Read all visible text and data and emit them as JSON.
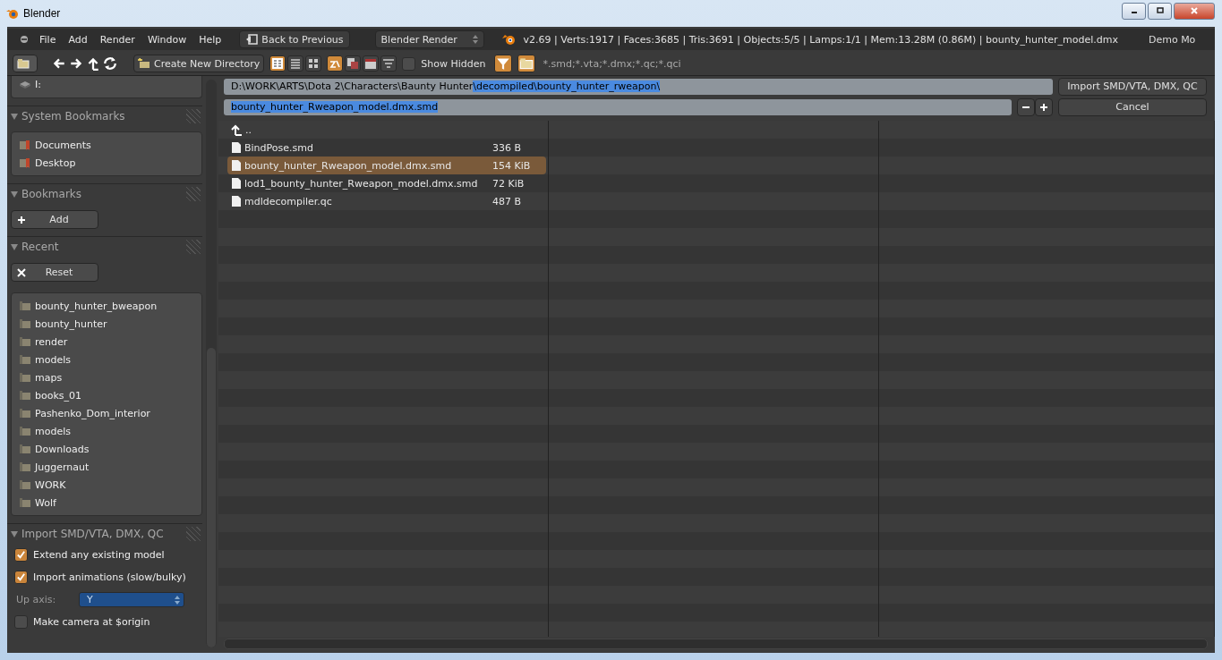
{
  "window": {
    "title": "Blender"
  },
  "menu": [
    "File",
    "Add",
    "Render",
    "Window",
    "Help"
  ],
  "back_button": "Back to Previous",
  "render_engine": "Blender Render",
  "stats": "v2.69 | Verts:1917 | Faces:3685 | Tris:3691 | Objects:5/5 | Lamps:1/1 | Mem:13.28M (0.86M) | bounty_hunter_model.dmx",
  "screen_layout": "Demo Mo",
  "toolbar": {
    "create_directory": "Create New Directory",
    "display_modes": [
      {
        "selected": true
      },
      {
        "selected": false
      },
      {
        "selected": false
      }
    ],
    "sort_modes": [
      {
        "selected": true
      },
      {
        "selected": false
      },
      {
        "selected": false
      },
      {
        "selected": false
      }
    ],
    "show_hidden": {
      "label": "Show Hidden",
      "checked": false
    },
    "filter": {
      "on": true
    },
    "folders_filter": {
      "on": true
    },
    "filter_glob": "*.smd;*.vta;*.dmx;*.qc;*.qci"
  },
  "path": {
    "text": "D:\\WORK\\ARTS\\Dota 2\\Characters\\Baunty Hunter",
    "selected_text": "\\decompiled\\bounty_hunter_rweapon\\"
  },
  "filename": {
    "value": "bounty_hunter_Rweapon_model.dmx.smd",
    "selected": true
  },
  "import_button": "Import SMD/VTA, DMX, QC",
  "cancel_button": "Cancel",
  "files": [
    {
      "kind": "parent",
      "name": "..",
      "selected": false
    },
    {
      "kind": "file",
      "name": "BindPose.smd",
      "size": "336 B",
      "selected": false
    },
    {
      "kind": "file",
      "name": "bounty_hunter_Rweapon_model.dmx.smd",
      "size": "154 KiB",
      "selected": true
    },
    {
      "kind": "file",
      "name": "lod1_bounty_hunter_Rweapon_model.dmx.smd",
      "size": "72 KiB",
      "selected": false
    },
    {
      "kind": "file",
      "name": "mdldecompiler.qc",
      "size": "487 B",
      "selected": false
    }
  ],
  "sidebar": {
    "drives": [
      "I:"
    ],
    "system_bookmarks": {
      "title": "System Bookmarks",
      "expanded": true,
      "items": [
        "Documents",
        "Desktop"
      ]
    },
    "bookmarks": {
      "title": "Bookmarks",
      "expanded": true,
      "add_button": "Add"
    },
    "recent": {
      "title": "Recent",
      "expanded": true,
      "reset_button": "Reset",
      "items": [
        "bounty_hunter_bweapon",
        "bounty_hunter",
        "render",
        "models",
        "maps",
        "books_01",
        "Pashenko_Dom_interior",
        "models",
        "Downloads",
        "Juggernaut",
        "WORK",
        "Wolf"
      ]
    },
    "import_panel": {
      "title": "Import SMD/VTA, DMX, QC",
      "expanded": true,
      "options": [
        {
          "kind": "checkbox",
          "label": "Extend any existing model",
          "checked": true
        },
        {
          "kind": "checkbox",
          "label": "Import animations (slow/bulky)",
          "checked": true
        },
        {
          "kind": "select",
          "label": "Up axis:",
          "value": "Y"
        },
        {
          "kind": "checkbox",
          "label": "Make camera at $origin",
          "checked": false
        }
      ]
    }
  }
}
